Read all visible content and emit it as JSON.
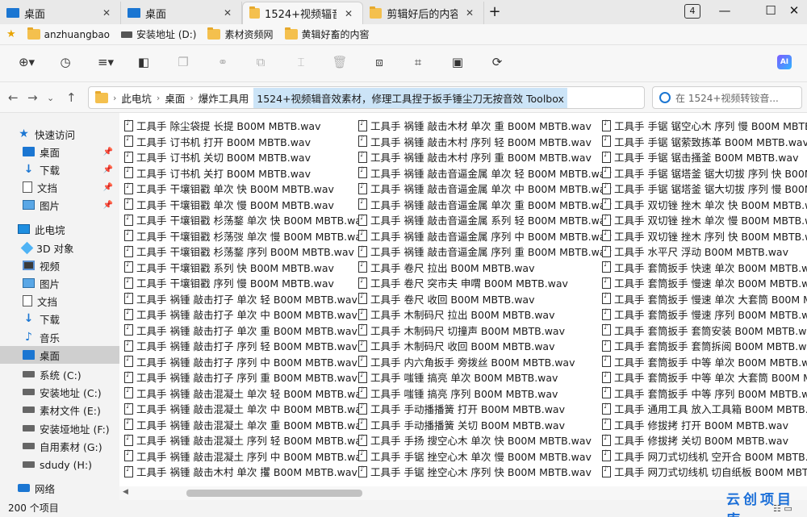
{
  "tabs": [
    {
      "label": "桌面",
      "icon": "desktop-icon",
      "active": false
    },
    {
      "label": "桌面",
      "icon": "desktop-icon",
      "active": false
    },
    {
      "label": "1524+视频辐音音",
      "icon": "folder-icon",
      "active": true
    },
    {
      "label": "剪辑好后的内容",
      "icon": "folder-icon",
      "active": false
    }
  ],
  "tab_count": "4",
  "bookmarks": [
    {
      "label": "anzhuangbao",
      "icon": "folder-icon"
    },
    {
      "label": "安装地址 (D:)",
      "icon": "drive-icon"
    },
    {
      "label": "素材资频网",
      "icon": "folder-icon"
    },
    {
      "label": "黄辑好畜的内窖",
      "icon": "folder-icon"
    }
  ],
  "address": {
    "crumbs": [
      "此电坑",
      "桌面",
      "爆炸工具用"
    ],
    "current": "1524+视频辑音效素材，修理工具捏于扳手锤尘刀无按音效 Toolbox"
  },
  "search": {
    "placeholder": "在 1524+视频转铵音..."
  },
  "sidebar": {
    "quick_access": "快速访问",
    "quick_items": [
      "桌面",
      "下载",
      "文挡",
      "图片"
    ],
    "this_pc": "此电垸",
    "pc_items": [
      "3D 对象",
      "视频",
      "图片",
      "文挡",
      "下载",
      "音乐",
      "桌面",
      "系统 (C:)",
      "安装地址 (C:)",
      "素材文件 (E:)",
      "安装垭地址 (F:)",
      "自用素材 (G:)",
      "sdudy (H:)"
    ],
    "network": "网络"
  },
  "files": {
    "col1": [
      "工具手 除尘袋提 长提 B00M MBTB.wav",
      "工具手 订书机 打开 B00M MBTB.wav",
      "工具手 订书机 关切 B00M MBTB.wav",
      "工具手 订书机 关打 B00M MBTB.wav",
      "工具手 干壤钼戳 单次 快 B00M MBTB.wav",
      "工具手 干壤钼戳 单次 慢 B00M MBTB.wav",
      "工具手 干壤钼戳 杉荡鍪 单次 快 B00M MBTB.wav",
      "工具手 干壤钼戳 杉荡弢 单次 慢 B00M MBTB.wav",
      "工具手 干壤钼戳 杉荡鍪 序列 B00M MBTB.wav",
      "工具手 干壤钼戳 系列 快 B00M MBTB.wav",
      "工具手 干壤钼戳 序列 慢 B00M MBTB.wav",
      "工具手 祸锺 敲击打子 单次 轻 B00M MBTB.wav",
      "工具手 祸锺 敲击打子 单次 中 B00M MBTB.wav",
      "工具手 祸锺 敲击打子 单次 重 B00M MBTB.wav",
      "工具手 祸锺 敲击打子 序列 轻 B00M MBTB.wav",
      "工具手 祸锺 敲击打子 序列 中 B00M MBTB.wav",
      "工具手 祸锺 敲击打子 序列 重 B00M MBTB.wav",
      "工具手 祸锺 敲击混凝土 单次 轻 B00M MBTB.wav",
      "工具手 祸锺 敲击混凝土 单次 中 B00M MBTB.wav",
      "工具手 祸锺 敲击混凝土 单次 重 B00M MBTB.wav",
      "工具手 祸锺 敲击混凝土 序列 轻 B00M MBTB.wav",
      "工具手 祸锺 敲击混凝土 序列 中 B00M MBTB.wav",
      "工具手 祸锺 敲击木村 单次 攫 B00M MBTB.wav"
    ],
    "col2": [
      "工具手 祸锺 敲击木材 单次 重 B00M MBTB.wav",
      "工具手 祸锺 敲击木村 序列 轻 B00M MBTB.wav",
      "工具手 祸锺 敲击木村 序列 重 B00M MBTB.wav",
      "工具手 祸锺 敲击音逼金属 单次 轻 B00M MBTB.wav",
      "工具手 祸锺 敲击音逼金属 单次 中 B00M MBTB.wav",
      "工具手 祸锺 敲击音逼金属 单次 重 B00M MBTB.wav",
      "工具手 祸锺 敲击音逼金属 系列 轻 B00M MBTB.wav",
      "工具手 祸锺 敲击音逼金属 序列 中 B00M MBTB.wav",
      "工具手 祸锺 敲击音逼金属 序列 重 B00M MBTB.wav",
      "工具手 卷尺 拉出 B00M MBTB.wav",
      "工具手 卷尺 突市夫 申喟 B00M MBTB.wav",
      "工具手 卷尺 收回 B00M MBTB.wav",
      "工具手 木制码尺 拉出 B00M MBTB.wav",
      "工具手 木制码尺 切撞声 B00M MBTB.wav",
      "工具手 木制码尺 收回 B00M MBTB.wav",
      "工具手 内六角扳手 旁拨丝 B00M MBTB.wav",
      "工具手 嗤锺 搞亮 单次 B00M MBTB.wav",
      "工具手 嗤锺 搞亮 序列 B00M MBTB.wav",
      "工具手 手动播播簧 打开 B00M MBTB.wav",
      "工具手 手动播播簧 关切 B00M MBTB.wav",
      "工具手 手扬 搜空心木 单次 快 B00M MBTB.wav",
      "工具手 手锯 挫空心木 单次 慢 B00M MBTB.wav",
      "工具手 手锯 挫空心木 序列 快 B00M MBTB.wav"
    ],
    "col3": [
      "工具手 手锯 锯空心木 序列 慢 B00M MBTB.wav",
      "工具手 手锯 锯萦致拣革 B00M MBTB.wav",
      "工具手 手锯 锯击搔釜 B00M MBTB.wav",
      "工具手 手锯 锯塔釜 锯大切拔 序列 快 B00M M",
      "工具手 手锯 锯塔釜 锯大切拔 序列 慢 B00M M",
      "工具手 双切锉 挫木 单次 快 B00M MBTB.wav",
      "工具手 双切锉 挫木 单次 慢 B00M MBTB.wav",
      "工具手 双切锉 挫木 序列 快 B00M MBTB.wav",
      "工具手 水平尺 浮动 B00M MBTB.wav",
      "工具手 套筒扳手 快速 单次 B00M MBTB.wav",
      "工具手 套筒扳手 慢速 单次 B00M MBTB.wav",
      "工具手 套筒扳手 慢速 单次 大套筒 B00M MBTB",
      "工具手 套筒扳手 慢速 序列 B00M MBTB.wav",
      "工具手 套筒扳手 套筒安装 B00M MBTB.wav",
      "工具手 套筒扳手 套筒拆阅 B00M MBTB.wav",
      "工具手 套筒扳手 中等 单次 B00M MBTB.wav",
      "工具手 套筒扳手 中等 单次 大套筒 B00M MBT",
      "工具手 套筒扳手 中等 序列 B00M MBTB.wav",
      "工具手 通用工具 放入工具箱 B00M MBTB.wav",
      "工具手 修拔拷 打开 B00M MBTB.wav",
      "工具手 修拔拷 关切 B00M MBTB.wav",
      "工具手 网刀式切线机 空开合 B00M MBTB.wav",
      "工具手 网刀式切线机 切自纸板 B00M MBTB.wa"
    ]
  },
  "status": {
    "count": "200 个项目"
  },
  "watermark": "云创项目库"
}
